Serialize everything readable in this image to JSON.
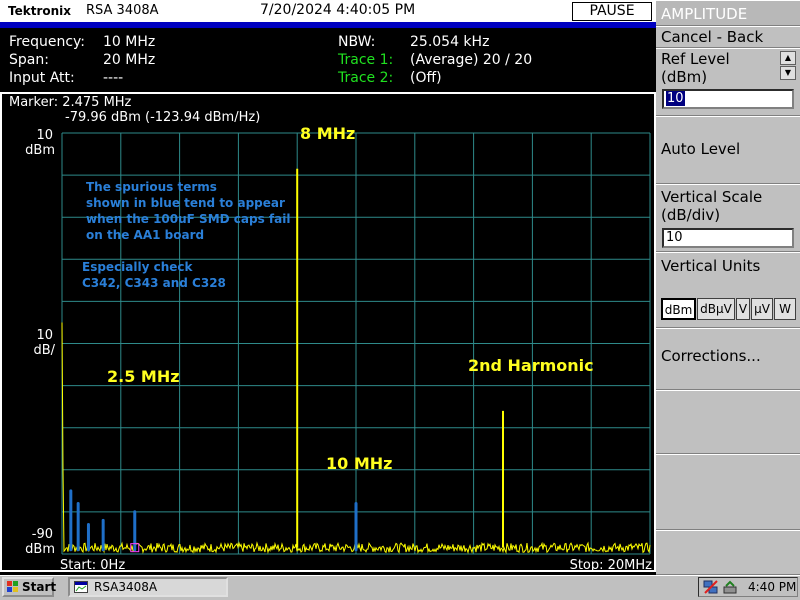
{
  "titlebar": {
    "brand": "Tektronix",
    "model": "RSA 3408A",
    "datetime": "7/20/2024 4:40:05 PM",
    "pause_label": "PAUSE"
  },
  "info": {
    "frequency_label": "Frequency:",
    "frequency_value": "10 MHz",
    "span_label": "Span:",
    "span_value": "20 MHz",
    "input_att_label": "Input Att:",
    "input_att_value": "----",
    "nbw_label": "NBW:",
    "nbw_value": "25.054 kHz",
    "trace1_label": "Trace 1:",
    "trace1_value": "(Average)  20 / 20",
    "trace2_label": "Trace 2:",
    "trace2_value": "(Off)"
  },
  "graph": {
    "marker_line1": "Marker: 2.475 MHz",
    "marker_line2": "-79.96 dBm (-123.94 dBm/Hz)",
    "ref_value": "10",
    "ref_unit": "dBm",
    "scale_value": "10",
    "scale_unit": "dB/",
    "bottom_value": "-90",
    "bottom_unit": "dBm",
    "start_label": "Start: 0Hz",
    "stop_label": "Stop: 20MHz"
  },
  "annotations": {
    "peak_8mhz": "8 MHz",
    "peak_2_5mhz": "2.5 MHz",
    "peak_10mhz": "10 MHz",
    "peak_2nd_harmonic": "2nd Harmonic",
    "note_line1": "The spurious terms",
    "note_line2": "shown in blue tend to appear",
    "note_line3": "when the 100uF SMD caps fail",
    "note_line4": "on the AA1 board",
    "check_line1": "Especially check",
    "check_line2": "C342, C343 and C328"
  },
  "menu": {
    "header": "AMPLITUDE",
    "cancel_back": "Cancel - Back",
    "ref_level_line1": "Ref Level",
    "ref_level_line2": "(dBm)",
    "ref_level_value": "10",
    "auto_level": "Auto Level",
    "vertical_scale_line1": "Vertical Scale",
    "vertical_scale_line2": "(dB/div)",
    "vertical_scale_value": "10",
    "vertical_units": "Vertical Units",
    "units": [
      "dBm",
      "dBµV",
      "V",
      "µV",
      "W"
    ],
    "selected_unit": "dBm",
    "corrections": "Corrections..."
  },
  "taskbar": {
    "start": "Start",
    "task": "RSA3408A",
    "clock": "4:40 PM"
  },
  "colors": {
    "trace": "#ffff00",
    "spur": "#1f6fc8",
    "grid": "#2e8a8a",
    "accent_green": "#20e020",
    "title_blue": "#0000c0"
  },
  "chart_data": {
    "type": "line",
    "xlabel": "",
    "ylabel": "",
    "x_unit": "MHz",
    "y_unit": "dBm",
    "xlim": [
      0,
      20
    ],
    "ylim": [
      -90,
      10
    ],
    "y_divisions_db": 10,
    "grid": true,
    "series": [
      {
        "name": "Trace 1",
        "color": "#ffff00",
        "peaks": [
          {
            "x": 8.0,
            "y": 1.5
          },
          {
            "x": 15.0,
            "y": -56
          }
        ],
        "noise_floor_dbm": -88.5
      },
      {
        "name": "",
        "color": "#1f6fc8",
        "peaks": [
          {
            "x": 0.3,
            "y": -75
          },
          {
            "x": 0.55,
            "y": -78
          },
          {
            "x": 0.9,
            "y": -83
          },
          {
            "x": 1.4,
            "y": -82
          },
          {
            "x": 2.475,
            "y": -79.96
          },
          {
            "x": 10.0,
            "y": -78
          }
        ]
      }
    ],
    "marker": {
      "x": 2.475,
      "y": -79.96
    }
  }
}
